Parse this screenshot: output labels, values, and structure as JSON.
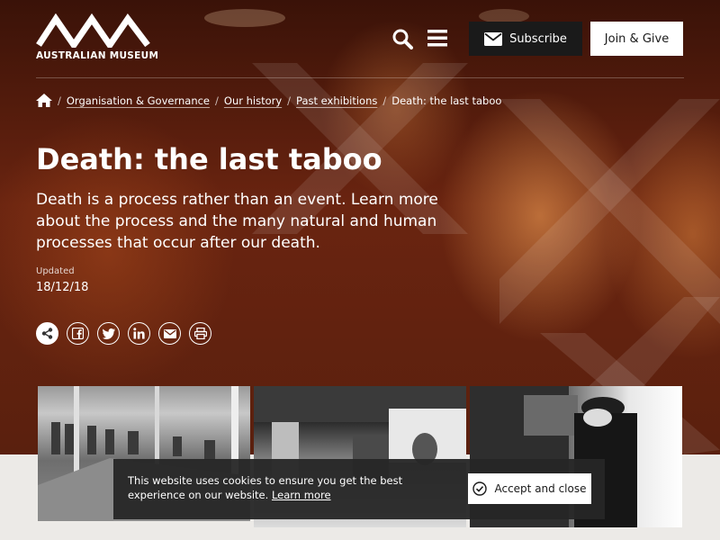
{
  "header": {
    "logo_text": "AUSTRALIAN MUSEUM",
    "subscribe_label": "Subscribe",
    "join_label": "Join & Give"
  },
  "breadcrumb": {
    "home_icon": "home-icon",
    "items": [
      "Organisation & Governance",
      "Our history",
      "Past exhibitions",
      "Death: the last taboo"
    ]
  },
  "page": {
    "title": "Death: the last taboo",
    "intro": "Death is a process rather than an event. Learn more about the process and the many natural and human processes that occur after our death.",
    "updated_label": "Updated",
    "updated_date": "18/12/18"
  },
  "share_icons": [
    "share-icon",
    "facebook-icon",
    "twitter-icon",
    "linkedin-icon",
    "email-icon",
    "print-icon"
  ],
  "cookie_banner": {
    "text": "This website uses cookies to ensure you get the best experience on our website.",
    "link_label": "Learn more",
    "accept_label": "Accept and close"
  },
  "colors": {
    "hero_dark": "#3a1208",
    "hero_orange": "#c0602a",
    "button_dark": "#1a1a1a",
    "banner_bg": "#262626"
  }
}
